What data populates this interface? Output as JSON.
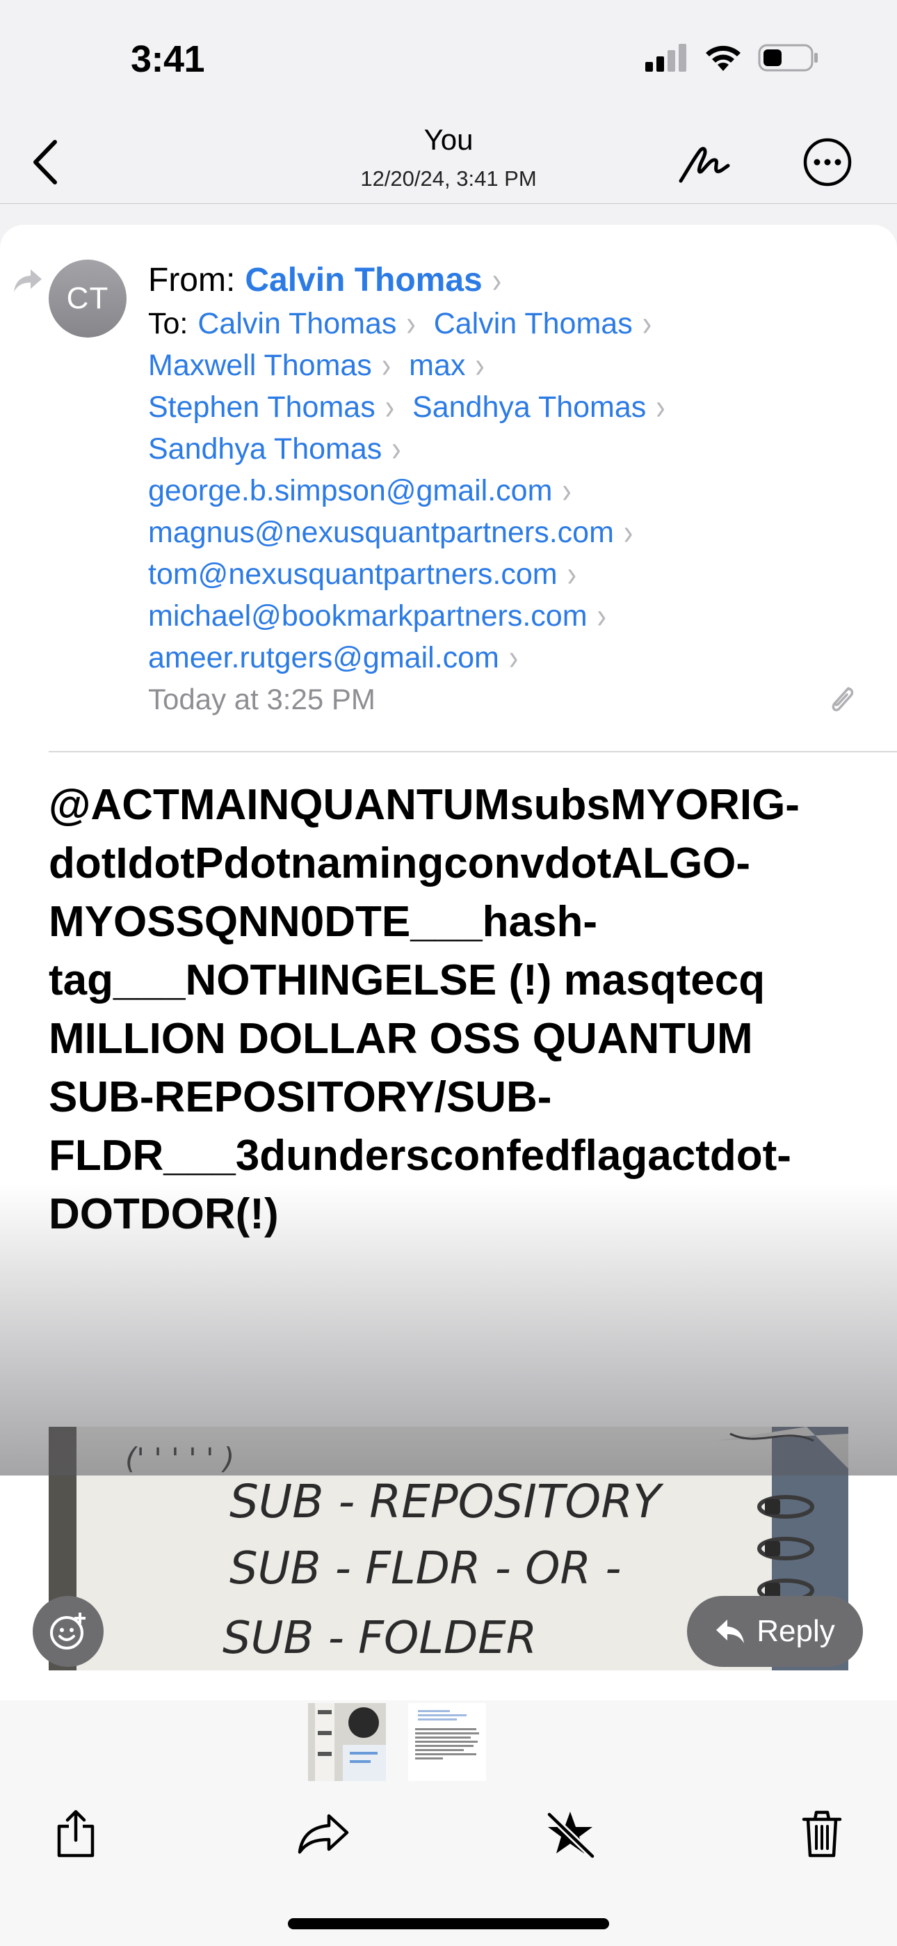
{
  "status_bar": {
    "time": "3:41"
  },
  "nav": {
    "title": "You",
    "subtitle": "12/20/24, 3:41 PM"
  },
  "message": {
    "avatar_initials": "CT",
    "from_label": "From:",
    "from_name": "Calvin Thomas",
    "to_label": "To:",
    "recipients_rows": [
      [
        "Calvin Thomas",
        "Calvin Thomas"
      ],
      [
        "Maxwell Thomas",
        "max"
      ],
      [
        "Stephen Thomas",
        "Sandhya Thomas"
      ],
      [
        "Sandhya Thomas"
      ],
      [
        "george.b.simpson@gmail.com"
      ],
      [
        "magnus@nexusquantpartners.com"
      ],
      [
        "tom@nexusquantpartners.com"
      ],
      [
        "michael@bookmarkpartners.com"
      ],
      [
        "ameer.rutgers@gmail.com"
      ]
    ],
    "date": "Today at 3:25 PM",
    "body": "@ACTMAINQUANTUMsubsMYORIG-dotIdotPdotnamingconvdotALGO-MYOSSQNN0DTE___hash-tag___NOTHINGELSE (!) masqtecq MILLION DOLLAR OSS QUANTUM SUB-REPOSITORY/SUB-FLDR___3dundersconfedflagactdot-DOTDOR(!)",
    "body_lines": [
      "@ACTMAINQUANTUMsubsMYORIG-",
      "dotIdotPdotnamingconvdotALGO-",
      "MYOSSQNN0DTE___hash-",
      "tag___NOTHINGELSE (!) masqtecq",
      "MILLION DOLLAR OSS QUANTUM",
      "SUB-REPOSITORY/SUB-",
      "FLDR___3dundersconfedflagactdot-",
      "DOTDOR(!)"
    ],
    "photo_handwriting": [
      "(' ' ' ' ' )",
      "SUB - REPOSITORY",
      "SUB - FLDR - OR -",
      "SUB - FOLDER"
    ]
  },
  "actions": {
    "reply_label": "Reply"
  },
  "icons": {
    "back": "chevron-left-icon",
    "markup": "markup-icon",
    "more": "ellipsis-circle-icon",
    "forwarded": "forwarded-arrow-icon",
    "attachment": "paperclip-icon",
    "emoji": "emoji-reaction-icon",
    "reply": "reply-arrow-icon",
    "share": "share-icon",
    "forward": "forward-icon",
    "flag": "star-slash-icon",
    "trash": "trash-icon"
  },
  "colors": {
    "link": "#2c7be5",
    "secondary": "#8e8e93"
  }
}
